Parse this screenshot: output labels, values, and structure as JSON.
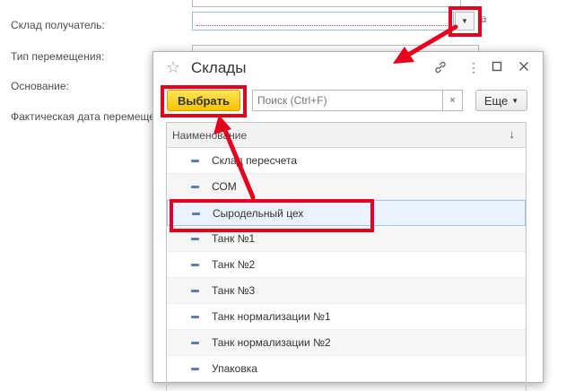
{
  "form": {
    "labels": {
      "recipient": "Склад получатель:",
      "move_type": "Тип перемещения:",
      "basis": "Основание:",
      "actual_date": "Фактическая дата перемещения"
    }
  },
  "dialog": {
    "title": "Склады",
    "select_label": "Выбрать",
    "search_placeholder": "Поиск (Ctrl+F)",
    "clear_glyph": "×",
    "more_label": "Еще",
    "column_header": "Наименование",
    "sort_glyph": "↓",
    "rows": [
      {
        "name": "Склад пересчета"
      },
      {
        "name": "СОМ"
      },
      {
        "name": "Сыродельный цех"
      },
      {
        "name": "Танк №1"
      },
      {
        "name": "Танк №2"
      },
      {
        "name": "Танк №3"
      },
      {
        "name": "Танк нормализации №1"
      },
      {
        "name": "Танк нормализации №2"
      },
      {
        "name": "Упаковка"
      }
    ],
    "selected_row": "Сыродельный цех"
  },
  "colors": {
    "accent_yellow": "#f5c400",
    "annotation_red": "#e8001c",
    "selection_blue": "#eaf3fd"
  }
}
